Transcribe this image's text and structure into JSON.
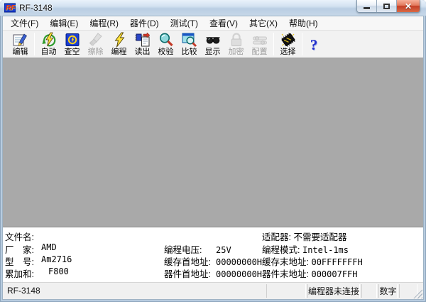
{
  "window": {
    "title": "RF-3148"
  },
  "menu": {
    "items": [
      {
        "label": "文件(F)"
      },
      {
        "label": "编辑(E)"
      },
      {
        "label": "编程(R)"
      },
      {
        "label": "器件(D)"
      },
      {
        "label": "测试(T)"
      },
      {
        "label": "查看(V)"
      },
      {
        "label": "其它(X)"
      },
      {
        "label": "帮助(H)"
      }
    ]
  },
  "toolbar": {
    "buttons": [
      {
        "label": "编辑",
        "icon": "edit-icon",
        "enabled": true
      },
      {
        "label": "自动",
        "icon": "auto-icon",
        "enabled": true
      },
      {
        "label": "查空",
        "icon": "blank-check-icon",
        "enabled": true
      },
      {
        "label": "擦除",
        "icon": "erase-icon",
        "enabled": false
      },
      {
        "label": "编程",
        "icon": "program-icon",
        "enabled": true
      },
      {
        "label": "读出",
        "icon": "read-icon",
        "enabled": true
      },
      {
        "label": "校验",
        "icon": "verify-icon",
        "enabled": true
      },
      {
        "label": "比较",
        "icon": "compare-icon",
        "enabled": true
      },
      {
        "label": "显示",
        "icon": "display-icon",
        "enabled": true
      },
      {
        "label": "加密",
        "icon": "encrypt-icon",
        "enabled": false
      },
      {
        "label": "配置",
        "icon": "config-icon",
        "enabled": false
      },
      {
        "label": "选择",
        "icon": "select-chip-icon",
        "enabled": true
      },
      {
        "label": "",
        "icon": "help-icon",
        "enabled": true,
        "glyph": "?"
      }
    ]
  },
  "info_panel": {
    "file": {
      "label": "文件名:",
      "value": ""
    },
    "manufacturer": {
      "label": "厂　家:",
      "value": "AMD"
    },
    "model": {
      "label": "型　号:",
      "value": "Am2716"
    },
    "checksum": {
      "label": "累加和:",
      "value": "F800"
    },
    "voltage": {
      "label": "编程电压:",
      "value": "25V"
    },
    "buffer_start": {
      "label": "缓存首地址:",
      "value": "00000000H"
    },
    "device_start": {
      "label": "器件首地址:",
      "value": "00000000H"
    },
    "adapter": {
      "label": "适配器:",
      "value": "不需要适配器"
    },
    "mode": {
      "label": "编程模式:",
      "value": "Intel-1ms"
    },
    "buffer_end": {
      "label": "缓存末地址:",
      "value": "00FFFFFFFH"
    },
    "device_end": {
      "label": "器件末地址:",
      "value": "000007FFH"
    }
  },
  "status_bar": {
    "left": "RF-3148",
    "connection": "编程器未连接",
    "numlock": "数字"
  },
  "colors": {
    "titlebar_blue": "#b7cbdf",
    "client_gray": "#a9a9a9",
    "close_red": "#c43e26",
    "help_blue": "#2230cc",
    "lightning_yellow": "#ffe23d",
    "blank_check_blue": "#1a3fd4"
  }
}
